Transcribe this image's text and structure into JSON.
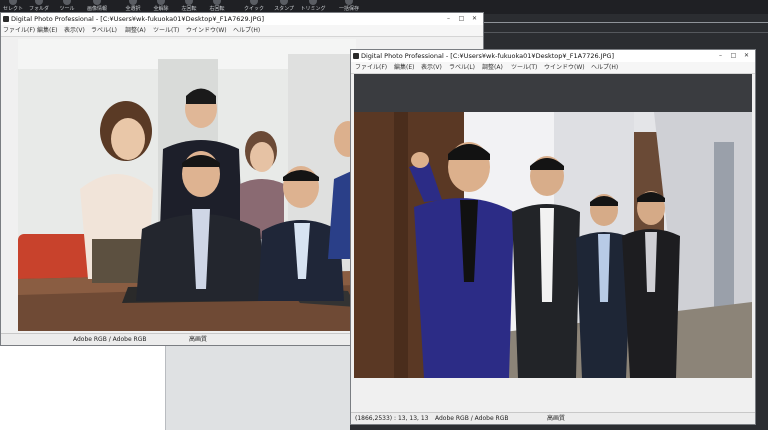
{
  "toolbar": {
    "items": [
      {
        "label": "セレクト",
        "icon": "select-icon"
      },
      {
        "label": "フォルダ",
        "icon": "folder-icon"
      },
      {
        "label": "ツール",
        "icon": "tool-icon"
      },
      {
        "label": "画像情報",
        "icon": "info-icon"
      },
      {
        "label": "全選択",
        "icon": "select-all-icon"
      },
      {
        "label": "全解除",
        "icon": "deselect-icon"
      },
      {
        "label": "左回転",
        "icon": "rotate-left-icon"
      },
      {
        "label": "右回転",
        "icon": "rotate-right-icon"
      },
      {
        "label": "クイック",
        "icon": "quick-check-icon"
      },
      {
        "label": "スタンプ",
        "icon": "stamp-icon"
      },
      {
        "label": "トリミング",
        "icon": "trim-icon"
      },
      {
        "label": "一括保存",
        "icon": "batch-save-icon"
      }
    ]
  },
  "window_left": {
    "title": "Digital Photo Professional - [C:¥Users¥wk-fukuoka01¥Desktop¥_F1A7629.JPG]",
    "menu": [
      "ファイル(F)",
      "編集(E)",
      "表示(V)",
      "ラベル(L)",
      "調整(A)",
      "ツール(T)",
      "ウインドウ(W)",
      "ヘルプ(H)"
    ],
    "status": {
      "color_space": "Adobe RGB / Adobe RGB",
      "quality": "高画質"
    }
  },
  "window_right": {
    "title": "Digital Photo Professional - [C:¥Users¥wk-fukuoka01¥Desktop¥_F1A7726.JPG]",
    "menu": [
      "ファイル(F)",
      "編集(E)",
      "表示(V)",
      "ラベル(L)",
      "調整(A)",
      "ツール(T)",
      "ウインドウ(W)",
      "ヘルプ(H)"
    ],
    "status": {
      "coords": "(1866,2533) : 13, 13, 13",
      "color_space": "Adobe RGB / Adobe RGB",
      "quality": "高画質"
    }
  },
  "window_buttons": {
    "minimize": "–",
    "maximize": "□",
    "close": "✕"
  },
  "colors": {
    "toolbar_bg": "#1f2024",
    "workspace_bg": "#2b2d31",
    "window_frame": "#f0f0f0",
    "suit_blue": "#2c2c86"
  }
}
